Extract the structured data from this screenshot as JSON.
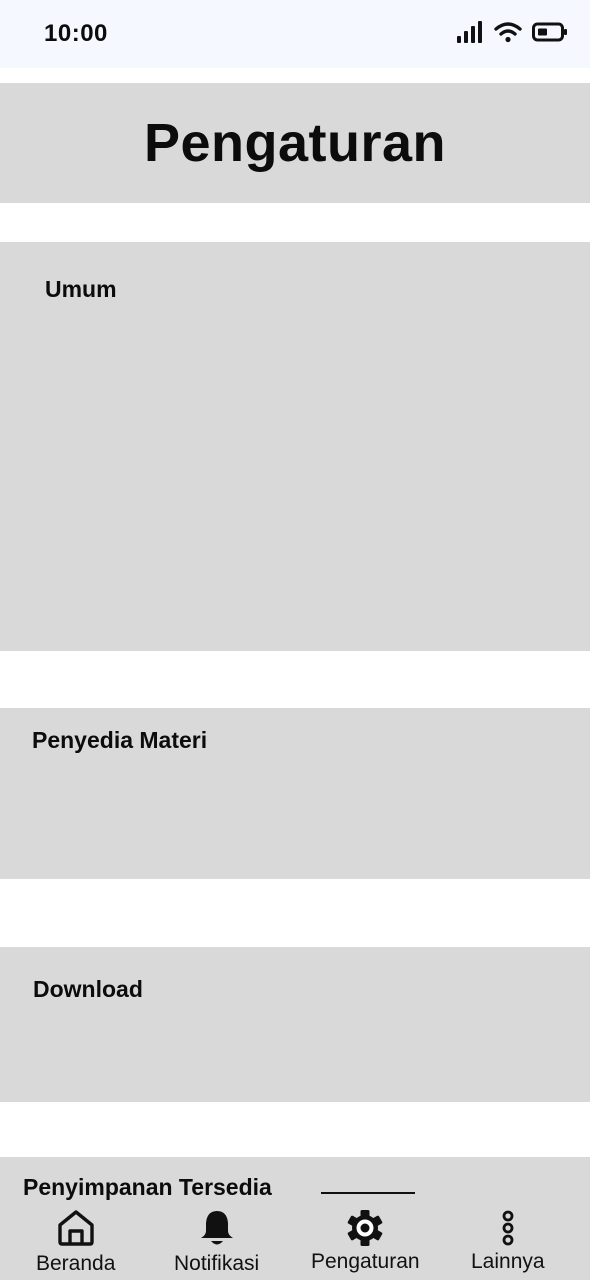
{
  "status_bar": {
    "time": "10:00",
    "icons": [
      "signal-icon",
      "wifi-icon",
      "battery-icon"
    ]
  },
  "header": {
    "title": "Pengaturan"
  },
  "sections": {
    "general": {
      "label": "Umum"
    },
    "content_provider": {
      "label": "Penyedia Materi"
    },
    "download": {
      "label": "Download"
    },
    "storage": {
      "label": "Penyimpanan Tersedia"
    }
  },
  "bottom_nav": {
    "items": [
      {
        "label": "Beranda",
        "icon": "home-icon"
      },
      {
        "label": "Notifikasi",
        "icon": "bell-icon"
      },
      {
        "label": "Pengaturan",
        "icon": "gear-icon"
      },
      {
        "label": "Lainnya",
        "icon": "more-vertical-icon"
      }
    ]
  },
  "colors": {
    "status_bar_bg": "#f5f9ff",
    "panel_bg": "#d9d9d9",
    "text": "#0c0c0c"
  }
}
